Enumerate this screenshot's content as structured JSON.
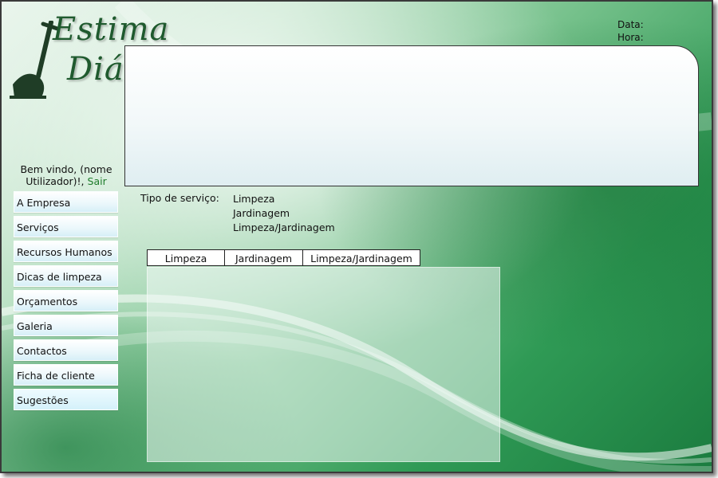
{
  "logo": {
    "line1": "Estima",
    "line2": "Diária"
  },
  "header": {
    "date_label": "Data:",
    "time_label": "Hora:"
  },
  "welcome": {
    "text": "Bem vindo, (nome Utilizador)!,",
    "logout_label": "Sair"
  },
  "menu": {
    "items": [
      {
        "label": "A Empresa"
      },
      {
        "label": "Serviços"
      },
      {
        "label": "Recursos Humanos"
      },
      {
        "label": "Dicas de limpeza"
      },
      {
        "label": "Orçamentos"
      },
      {
        "label": "Galeria"
      },
      {
        "label": "Contactos"
      },
      {
        "label": "Ficha de cliente"
      },
      {
        "label": "Sugestões"
      }
    ]
  },
  "service": {
    "label": "Tipo de serviço:",
    "options": [
      "Limpeza",
      "Jardinagem",
      "Limpeza/Jardinagem"
    ]
  },
  "tabs": [
    "Limpeza",
    "Jardinagem",
    "Limpeza/Jardinagem"
  ],
  "colors": {
    "brand_green": "#1f5a2e",
    "logout_link": "#1e7c2b"
  }
}
